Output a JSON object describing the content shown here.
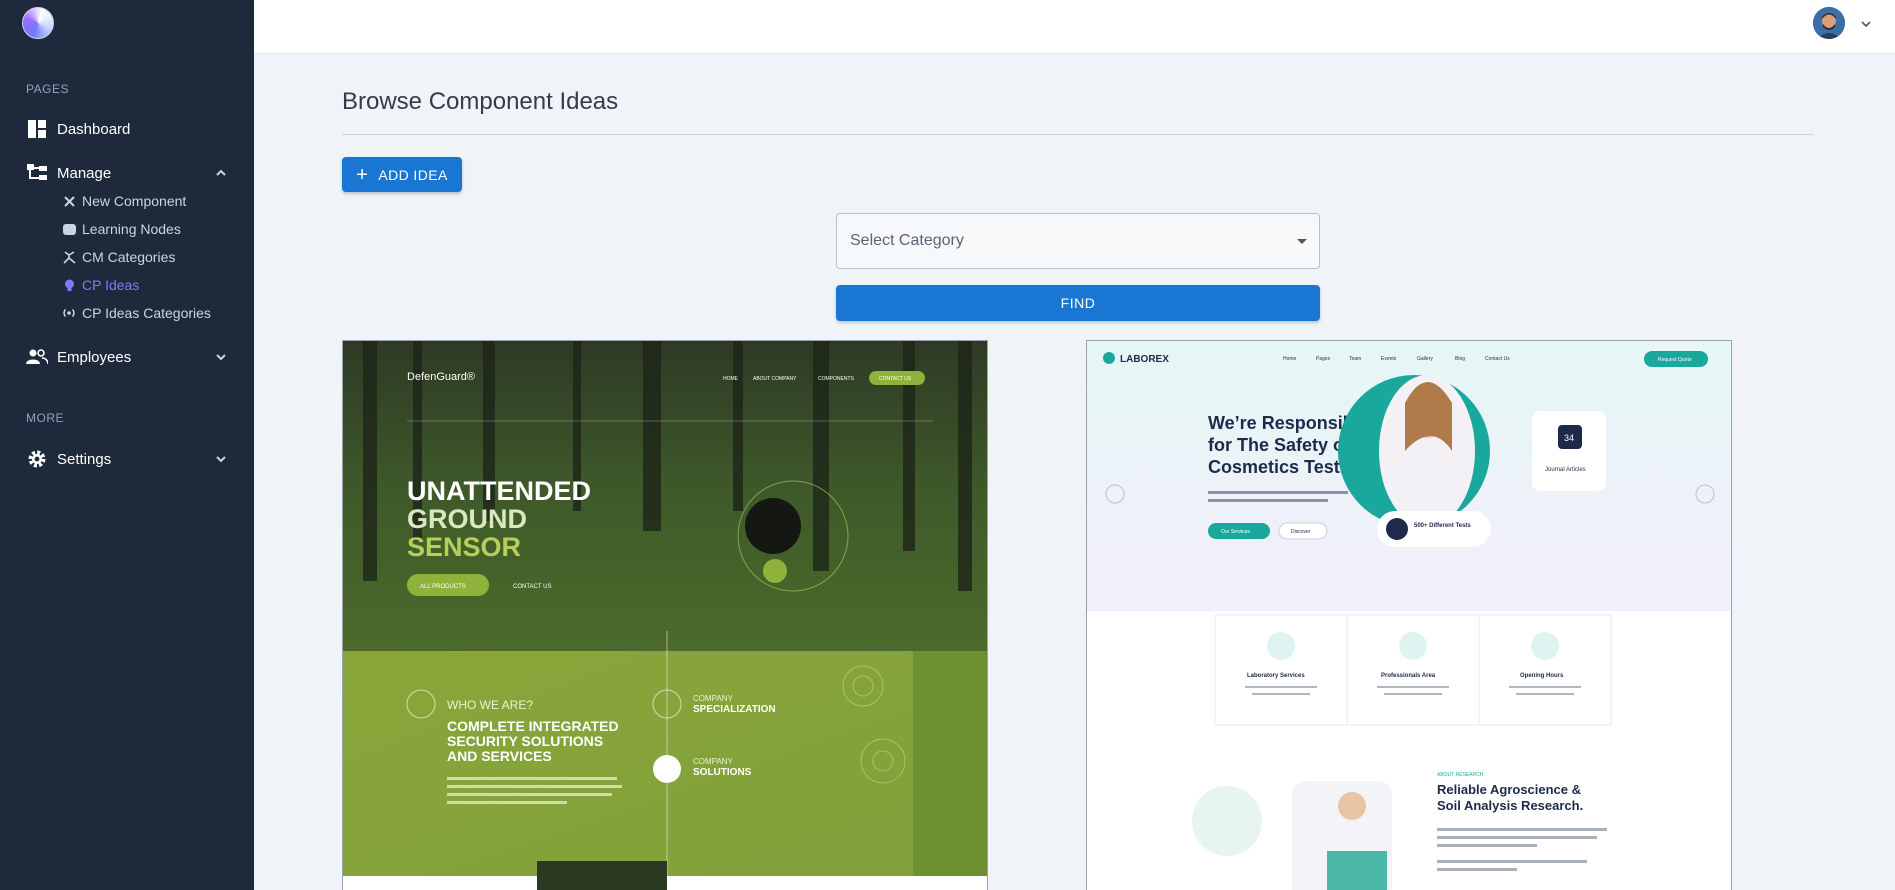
{
  "sidebar": {
    "pages_label": "PAGES",
    "more_label": "MORE",
    "dashboard": "Dashboard",
    "manage": "Manage",
    "sub_items": [
      {
        "label": "New Component",
        "icon": "tools-icon"
      },
      {
        "label": "Learning Nodes",
        "icon": "node-icon"
      },
      {
        "label": "CM Categories",
        "icon": "branch-icon"
      },
      {
        "label": "CP Ideas",
        "icon": "bulb-icon",
        "active": true
      },
      {
        "label": "CP Ideas Categories",
        "icon": "broadcast-icon"
      }
    ],
    "employees": "Employees",
    "settings": "Settings"
  },
  "main": {
    "title": "Browse Component Ideas",
    "add_button": "ADD IDEA",
    "select_placeholder": "Select Category",
    "find_button": "FIND"
  },
  "cards": {
    "card1": {
      "brand": "DefenGuard®",
      "nav": [
        "HOME",
        "ABOUT COMPANY",
        "COMPONENTS",
        "CONTACT US"
      ],
      "hero_line1": "UNATTENDED",
      "hero_line2": "GROUND",
      "hero_line3": "SENSOR",
      "btn_products": "ALL PRODUCTS",
      "btn_contact": "CONTACT US",
      "who": "WHO WE ARE?",
      "complete1": "COMPLETE INTEGRATED",
      "complete2": "SECURITY SOLUTIONS",
      "complete3": "AND SERVICES",
      "company1": "COMPANY",
      "specialization": "SPECIALIZATION",
      "company2": "COMPANY",
      "solutions": "SOLUTIONS"
    },
    "card2": {
      "brand": "LABOREX",
      "nav": [
        "Home",
        "Pages",
        "Team",
        "Events",
        "Gallery",
        "Blog",
        "Contact Us"
      ],
      "request_btn": "Request Quote",
      "hero1": "We’re Responsible",
      "hero2": "for The Safety of",
      "hero3": "Cosmetics Testing",
      "btn_services": "Our Services",
      "btn_discover": "Discover",
      "badge_num": "34",
      "badge_label": "Journal Articles",
      "tests": "500+ Different Tests",
      "service1": "Laboratory Services",
      "service2": "Professionals Area",
      "service3": "Opening Hours",
      "about": "ABOUT RESEARCH",
      "reliable1": "Reliable Agroscience &",
      "reliable2": "Soil Analysis Research."
    }
  },
  "colors": {
    "sidebar_bg": "#1e293b",
    "primary": "#1976d2",
    "active": "#7c7cff"
  }
}
